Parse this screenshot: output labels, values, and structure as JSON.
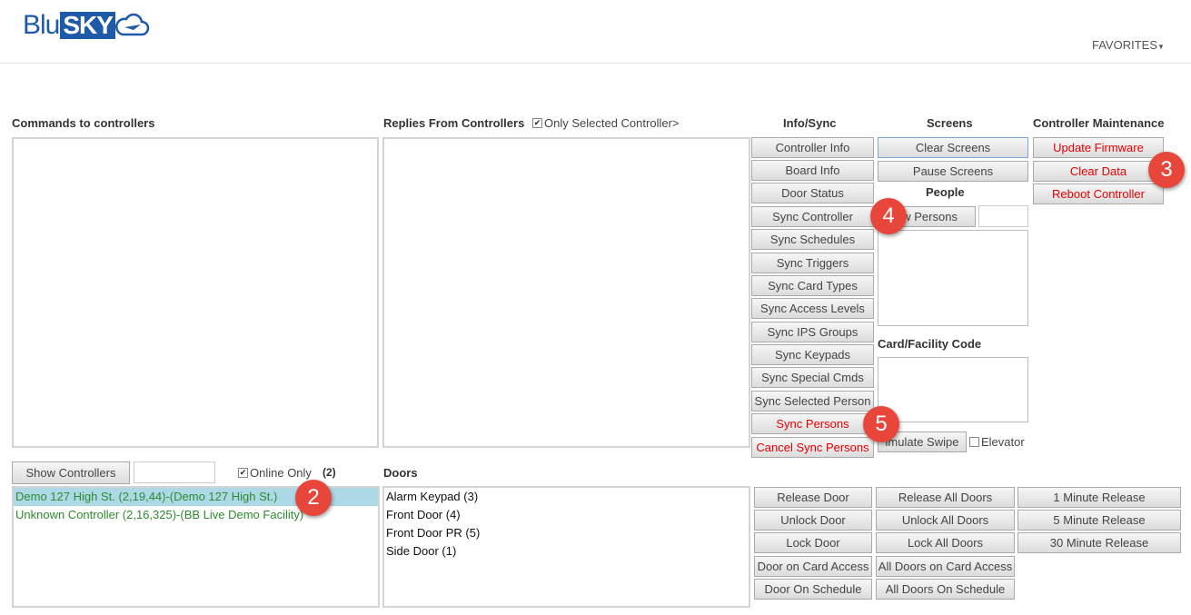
{
  "header": {
    "logo_left": "Blu",
    "logo_right": "SKY",
    "favorites": "FAVORITES"
  },
  "commands": {
    "title": "Commands to controllers"
  },
  "replies": {
    "title": "Replies From Controllers",
    "only_selected": "Only Selected Controller>"
  },
  "info_sync": {
    "title": "Info/Sync",
    "buttons": [
      "Controller Info",
      "Board Info",
      "Door Status",
      "Sync Controller",
      "Sync Schedules",
      "Sync Triggers",
      "Sync Card Types",
      "Sync Access Levels",
      "Sync IPS Groups",
      "Sync Keypads",
      "Sync Special Cmds",
      "Sync Selected Person",
      "Sync Persons",
      "Cancel Sync Persons"
    ]
  },
  "screens": {
    "title": "Screens",
    "clear": "Clear Screens",
    "pause": "Pause Screens"
  },
  "people": {
    "title": "People",
    "show_persons": "ow Persons"
  },
  "card_facility": {
    "title": "Card/Facility Code",
    "simulate": "imulate Swipe",
    "elevator": "Elevator"
  },
  "maintenance": {
    "title": "Controller Maintenance",
    "update": "Update Firmware",
    "clear": "Clear Data",
    "reboot": "Reboot Controller"
  },
  "controllers": {
    "show_button": "Show Controllers",
    "online_only": "Online Only",
    "count": "(2)",
    "items": [
      "Demo 127 High St. (2,19,44)-(Demo 127 High St.)",
      "Unknown Controller (2,16,325)-(BB Live Demo Facility)"
    ]
  },
  "doors": {
    "title": "Doors",
    "items": [
      "Alarm Keypad (3)",
      "Front Door (4)",
      "Front Door PR (5)",
      "Side Door (1)"
    ],
    "col1": [
      "Release Door",
      "Unlock Door",
      "Lock Door",
      "Door on Card Access",
      "Door On Schedule"
    ],
    "col2": [
      "Release All Doors",
      "Unlock All Doors",
      "Lock All Doors",
      "All Doors on Card Access",
      "All Doors On Schedule"
    ],
    "col3": [
      "1 Minute Release",
      "5 Minute Release",
      "30 Minute Release"
    ]
  },
  "badges": [
    "2",
    "3",
    "4",
    "5"
  ],
  "colors": {
    "brand": "#1e5aa8",
    "danger": "#e60000",
    "badge": "#e8463a",
    "selected_row": "#add8e6",
    "controller_text": "#2e8b2e"
  }
}
